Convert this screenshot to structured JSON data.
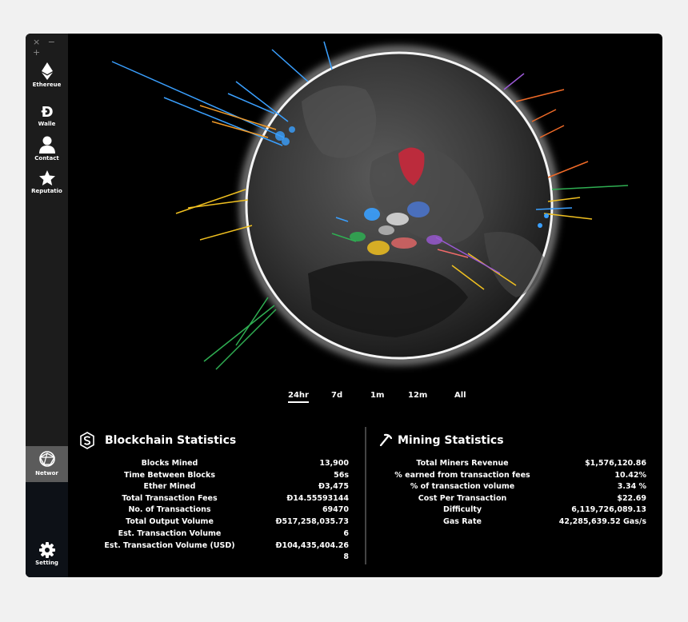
{
  "window_controls": "× − +",
  "sidebar": {
    "items": [
      {
        "label": "Ethereue",
        "icon": "ethereum-icon"
      },
      {
        "label": "Walle",
        "icon": "dao-d-icon"
      },
      {
        "label": "Contact",
        "icon": "user-icon"
      },
      {
        "label": "Reputatio",
        "icon": "star-icon"
      }
    ],
    "active_item": {
      "label": "Networ",
      "icon": "network-icon"
    },
    "settings": {
      "label": "Setting",
      "icon": "gear-icon"
    }
  },
  "periods": [
    "24hr",
    "7d",
    "1m",
    "12m",
    "All"
  ],
  "selected_period": "24hr",
  "blockchain": {
    "title": "Blockchain Statistics",
    "icon": "blockchain-s-icon",
    "rows": [
      {
        "label": "Blocks Mined",
        "value": "13,900"
      },
      {
        "label": "Time Between Blocks",
        "value": "56s"
      },
      {
        "label": "Ether Mined",
        "value": "Ð3,475"
      },
      {
        "label": "Total Transaction Fees",
        "value": "Ð14.55593144"
      },
      {
        "label": "No. of Transactions",
        "value": "69470"
      },
      {
        "label": "Total Output Volume",
        "value": "Ð517,258,035.73"
      },
      {
        "label": "Est. Transaction Volume",
        "value": "6"
      },
      {
        "label": "Est. Transaction Volume (USD)",
        "value": "Ð104,435,404.26"
      },
      {
        "label": "",
        "value": "8"
      }
    ]
  },
  "mining": {
    "title": "Mining Statistics",
    "icon": "pickaxe-icon",
    "rows": [
      {
        "label": "Total Miners Revenue",
        "value": "$1,576,120.86"
      },
      {
        "label": "% earned from transaction fees",
        "value": "10.42%"
      },
      {
        "label": "% of transaction volume",
        "value": "3.34 %"
      },
      {
        "label": "Cost Per Transaction",
        "value": "$22.69"
      },
      {
        "label": "Difficulty",
        "value": "6,119,726,089.13"
      },
      {
        "label": "Gas Rate",
        "value": "42,285,639.52 Gas/s"
      }
    ]
  }
}
